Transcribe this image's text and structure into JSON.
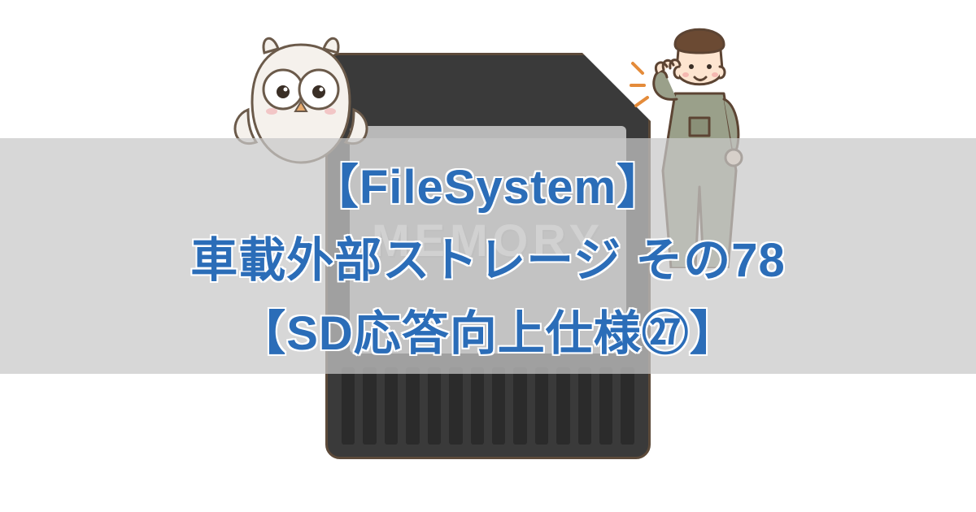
{
  "illustration": {
    "sd_label": "MEMORY",
    "owl_name": "owl-mascot",
    "worker_name": "worker-mascot"
  },
  "title": {
    "line1": "【FileSystem】",
    "line2": "車載外部ストレージ その78",
    "line3": "【SD応答向上仕様㉗】"
  },
  "colors": {
    "title_text": "#2b6db8",
    "band_bg": "rgba(200,200,200,0.72)",
    "sd_body": "#3a3a3a",
    "sd_label_bg": "#b8b8b8"
  }
}
